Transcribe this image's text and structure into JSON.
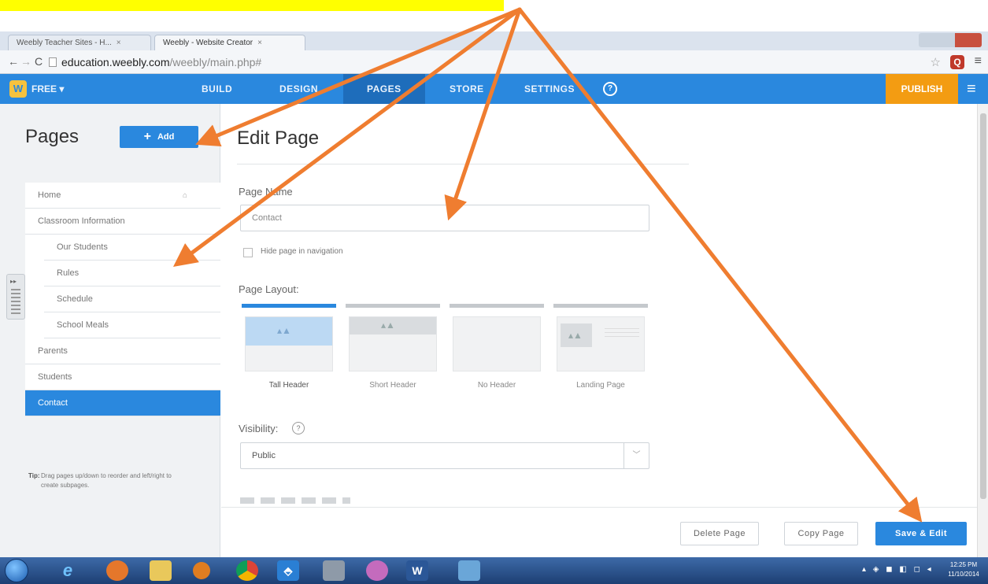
{
  "browser": {
    "tabs": [
      {
        "label": "Weebly Teacher Sites - H..."
      },
      {
        "label": "Weebly - Website Creator"
      }
    ],
    "tab_close_icon": "close-icon",
    "url_main": "education.weebly.com",
    "url_path": "/weebly/main.php#"
  },
  "weebly_bar": {
    "logo_letter": "W",
    "plan": "FREE ▾",
    "nav": [
      "BUILD",
      "DESIGN",
      "PAGES",
      "STORE",
      "SETTINGS"
    ],
    "active_nav": "PAGES",
    "help": "?",
    "publish": "PUBLISH"
  },
  "sidebar": {
    "title": "Pages",
    "add_label": "Add",
    "pages": [
      {
        "label": "Home",
        "level": 0,
        "home": true
      },
      {
        "label": "Classroom Information",
        "level": 0
      },
      {
        "label": "Our Students",
        "level": 1
      },
      {
        "label": "Rules",
        "level": 1
      },
      {
        "label": "Schedule",
        "level": 1
      },
      {
        "label": "School Meals",
        "level": 1
      },
      {
        "label": "Parents",
        "level": 0
      },
      {
        "label": "Students",
        "level": 0
      },
      {
        "label": "Contact",
        "level": 0,
        "active": true
      }
    ],
    "tip_label": "Tip:",
    "tip_text": "Drag pages up/down to reorder and left/right to create subpages."
  },
  "edit_page": {
    "title": "Edit Page",
    "page_name_label": "Page Name",
    "page_name_value": "Contact",
    "hide_label": "Hide page in navigation",
    "layout_label": "Page Layout:",
    "layouts": [
      {
        "label": "Tall Header",
        "selected": true
      },
      {
        "label": "Short Header"
      },
      {
        "label": "No Header"
      },
      {
        "label": "Landing Page"
      }
    ],
    "visibility_label": "Visibility:",
    "visibility_value": "Public"
  },
  "footer": {
    "delete": "Delete Page",
    "copy": "Copy Page",
    "save": "Save & Edit"
  },
  "taskbar": {
    "clock_time": "12:25 PM",
    "clock_date": "11/10/2014"
  },
  "colors": {
    "weebly_blue": "#2a88de",
    "publish_orange": "#f39c12",
    "annotation_arrow": "#ef7d30",
    "highlight": "#ffff00"
  }
}
